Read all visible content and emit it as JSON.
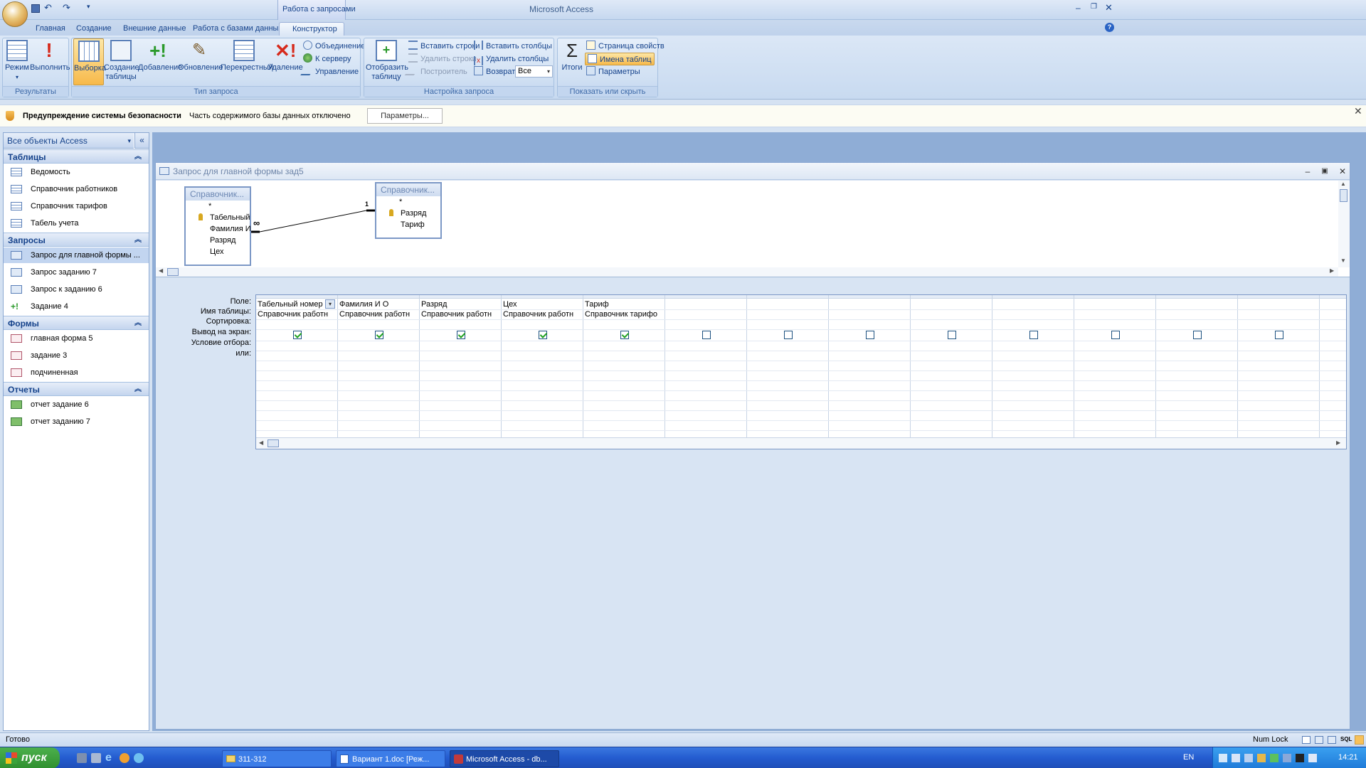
{
  "titlebar": {
    "context_tab_label": "Работа с запросами",
    "app_title": "Microsoft Access",
    "quick_access": {
      "save": "save-icon",
      "undo": "undo-icon",
      "redo": "redo-icon"
    }
  },
  "tabs": [
    {
      "label": "Главная"
    },
    {
      "label": "Создание"
    },
    {
      "label": "Внешние данные"
    },
    {
      "label": "Работа с базами данных"
    },
    {
      "label": "Конструктор"
    }
  ],
  "ribbon": {
    "results": {
      "label": "Результаты",
      "mode": "Режим",
      "run": "Выполнить"
    },
    "query_type": {
      "label": "Тип запроса",
      "select": "Выборка",
      "make_table": "Создание таблицы",
      "append": "Добавление",
      "update": "Обновление",
      "crosstab": "Перекрестный",
      "delete": "Удаление",
      "union": "Объединение",
      "to_server": "К серверу",
      "management": "Управление"
    },
    "setup": {
      "label": "Настройка запроса",
      "show_table": "Отобразить таблицу",
      "insert_rows": "Вставить строки",
      "delete_rows": "Удалить строки",
      "builder": "Построитель",
      "insert_cols": "Вставить столбцы",
      "delete_cols": "Удалить столбцы",
      "return_label": "Возврат:",
      "return_value": "Все"
    },
    "show_hide": {
      "label": "Показать или скрыть",
      "totals": "Итоги",
      "property_sheet": "Страница свойств",
      "table_names": "Имена таблиц",
      "parameters": "Параметры"
    }
  },
  "security": {
    "title": "Предупреждение системы безопасности",
    "message": "Часть содержимого базы данных отключено",
    "button": "Параметры..."
  },
  "nav": {
    "header": "Все объекты Access",
    "groups": {
      "tables": {
        "label": "Таблицы",
        "items": [
          "Ведомость",
          "Справочник работников",
          "Справочник тарифов",
          "Табель учета"
        ]
      },
      "queries": {
        "label": "Запросы",
        "items": [
          "Запрос для главной формы ...",
          "Запрос заданию 7",
          "Запрос к заданию 6",
          "Задание 4"
        ]
      },
      "forms": {
        "label": "Формы",
        "items": [
          "главная форма 5",
          "задание 3",
          "подчиненная"
        ]
      },
      "reports": {
        "label": "Отчеты",
        "items": [
          "отчет задание 6",
          "отчет заданию 7"
        ]
      }
    }
  },
  "query_window": {
    "title": "Запрос для главной формы зад5",
    "table1": {
      "title": "Справочник...",
      "fields": [
        "*",
        "Табельный",
        "Фамилия И",
        "Разряд",
        "Цех"
      ]
    },
    "table2": {
      "title": "Справочник...",
      "fields": [
        "*",
        "Разряд",
        "Тариф"
      ]
    },
    "join": {
      "left": "∞",
      "right": "1"
    },
    "row_labels": [
      "Поле:",
      "Имя таблицы:",
      "Сортировка:",
      "Вывод на экран:",
      "Условие отбора:",
      "или:"
    ],
    "columns": [
      {
        "field": "Табельный номер",
        "table": "Справочник работн",
        "show": true
      },
      {
        "field": "Фамилия И О",
        "table": "Справочник работн",
        "show": true
      },
      {
        "field": "Разряд",
        "table": "Справочник работн",
        "show": true
      },
      {
        "field": "Цех",
        "table": "Справочник работн",
        "show": true
      },
      {
        "field": "Тариф",
        "table": "Справочник тарифо",
        "show": true
      },
      {
        "field": "",
        "table": "",
        "show": false
      },
      {
        "field": "",
        "table": "",
        "show": false
      },
      {
        "field": "",
        "table": "",
        "show": false
      },
      {
        "field": "",
        "table": "",
        "show": false
      },
      {
        "field": "",
        "table": "",
        "show": false
      },
      {
        "field": "",
        "table": "",
        "show": false
      },
      {
        "field": "",
        "table": "",
        "show": false
      },
      {
        "field": "",
        "table": "",
        "show": false
      }
    ]
  },
  "status": {
    "left": "Готово",
    "numlock": "Num Lock"
  },
  "taskbar": {
    "start": "пуск",
    "windows": [
      "311-312",
      "Вариант 1.doc [Реж...",
      "Microsoft Access - db..."
    ],
    "lang": "EN",
    "clock": "14:21"
  }
}
